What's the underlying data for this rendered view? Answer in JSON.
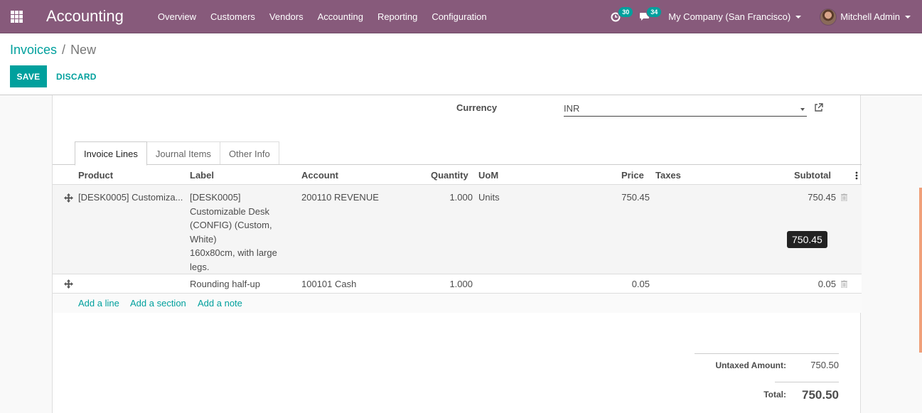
{
  "navbar": {
    "app_title": "Accounting",
    "menu": [
      "Overview",
      "Customers",
      "Vendors",
      "Accounting",
      "Reporting",
      "Configuration"
    ],
    "activity_count": "30",
    "messages_count": "34",
    "company": "My Company (San Francisco)",
    "user": "Mitchell Admin",
    "icons": {
      "apps": "apps-grid-icon",
      "activity": "clock-icon",
      "messages": "chat-icon"
    }
  },
  "breadcrumb": {
    "parent": "Invoices",
    "separator": "/",
    "current": "New"
  },
  "actions": {
    "save": "SAVE",
    "discard": "DISCARD"
  },
  "form": {
    "currency_label": "Currency",
    "currency_value": "INR"
  },
  "tabs": [
    "Invoice Lines",
    "Journal Items",
    "Other Info"
  ],
  "table": {
    "headers": {
      "product": "Product",
      "label": "Label",
      "account": "Account",
      "quantity": "Quantity",
      "uom": "UoM",
      "price": "Price",
      "taxes": "Taxes",
      "subtotal": "Subtotal"
    },
    "rows": [
      {
        "product": "[DESK0005] Customiza...",
        "label_lines": [
          "[DESK0005]",
          "Customizable Desk",
          "(CONFIG) (Custom,",
          "White)",
          "160x80cm, with large",
          "legs."
        ],
        "account": "200110 REVENUE",
        "quantity": "1.000",
        "uom": "Units",
        "price": "750.45",
        "subtotal": "750.45"
      },
      {
        "product": "",
        "label": "Rounding half-up",
        "account": "100101 Cash",
        "quantity": "1.000",
        "uom": "",
        "price": "0.05",
        "subtotal": "0.05"
      }
    ],
    "add_links": [
      "Add a line",
      "Add a section",
      "Add a note"
    ],
    "tooltip": "750.45"
  },
  "totals": {
    "untaxed_label": "Untaxed Amount:",
    "untaxed_value": "750.50",
    "total_label": "Total:",
    "total_value": "750.50"
  },
  "colors": {
    "brand": "#875a7b",
    "accent": "#00a09d"
  }
}
